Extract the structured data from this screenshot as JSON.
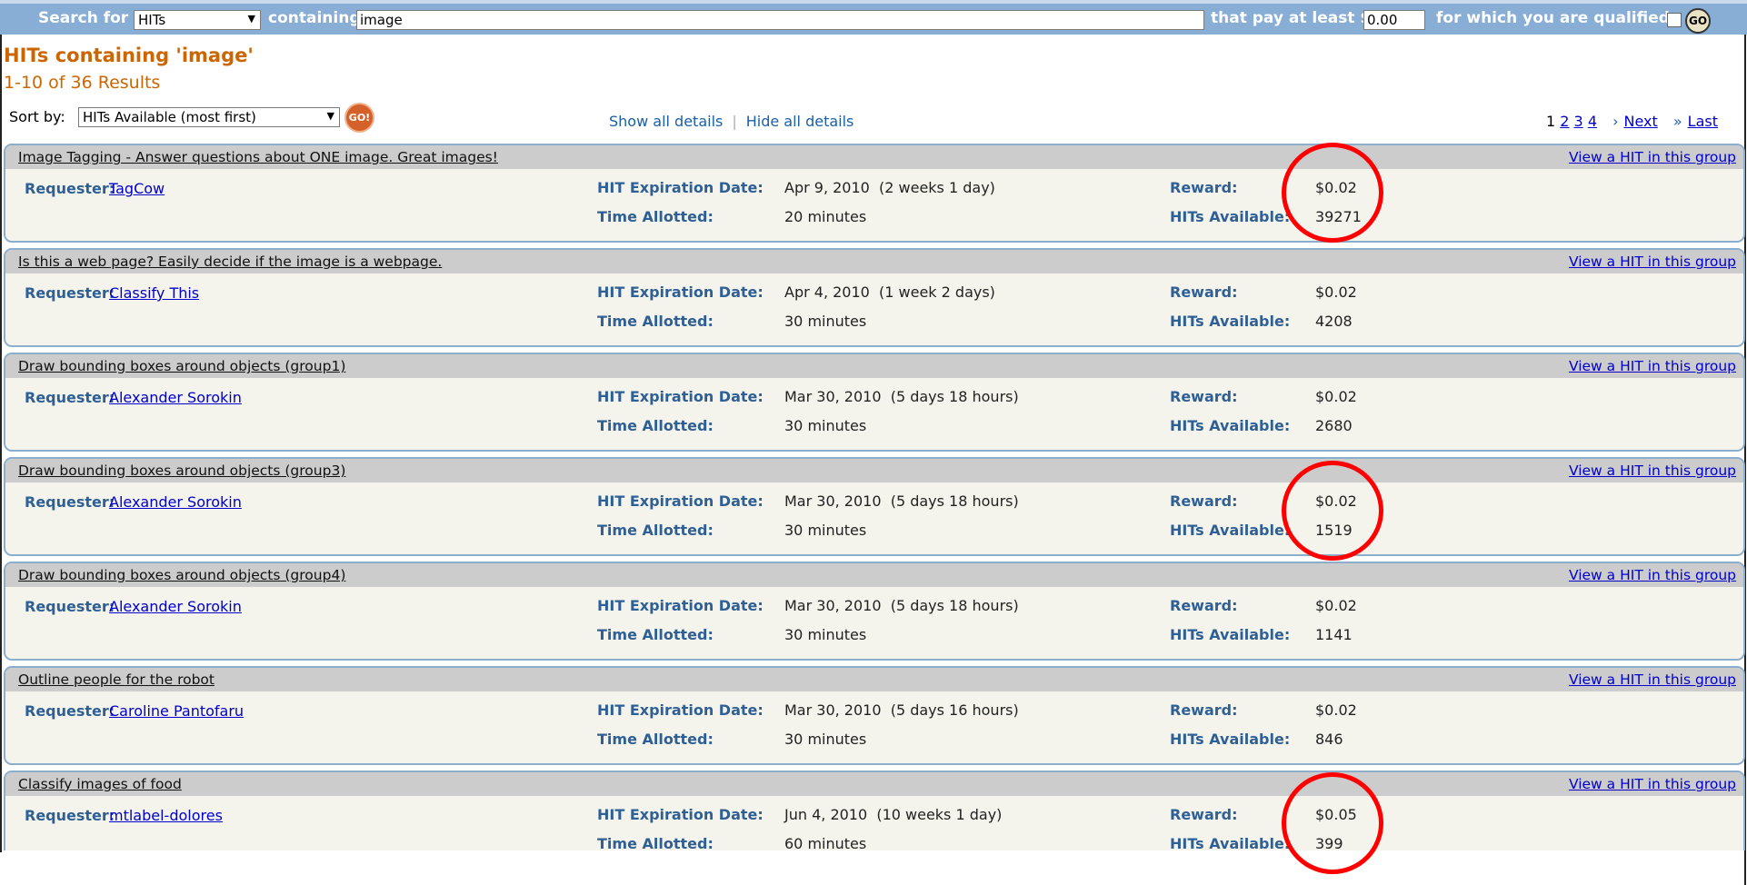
{
  "search": {
    "search_for_label": "Search for",
    "type_value": "HITs",
    "containing_label": "containing",
    "keyword_value": "image",
    "pay_label": "that pay at least $",
    "reward_value": "0.00",
    "qualified_label": "for which you are qualified",
    "go_label": "GO"
  },
  "results": {
    "heading": "HITs containing 'image'",
    "count": "1-10 of 36 Results",
    "sort_label": "Sort by:",
    "sort_value": "HITs Available (most first)",
    "sort_go": "GO!",
    "show_all": "Show all details",
    "hide_all": "Hide all details",
    "sep": "|"
  },
  "pager": {
    "pages": [
      "1",
      "2",
      "3",
      "4"
    ],
    "next": "Next",
    "last": "Last",
    "chev": "›",
    "chev2": "»"
  },
  "labels": {
    "requester": "Requester:",
    "expiration": "HIT Expiration Date:",
    "allotted": "Time Allotted:",
    "reward": "Reward:",
    "available": "HITs Available:",
    "view": "View a HIT in this group"
  },
  "hits": [
    {
      "title": "Image Tagging - Answer questions about ONE image. Great images!",
      "requester": "TagCow",
      "expiration": "Apr 9, 2010  (2 weeks 1 day)",
      "allotted": "20 minutes",
      "reward": "$0.02",
      "available": "39271"
    },
    {
      "title": "Is this a web page? Easily decide if the image is a webpage.",
      "requester": "Classify This",
      "expiration": "Apr 4, 2010  (1 week 2 days)",
      "allotted": "30 minutes",
      "reward": "$0.02",
      "available": "4208"
    },
    {
      "title": "Draw bounding boxes around objects (group1)",
      "requester": "Alexander Sorokin",
      "expiration": "Mar 30, 2010  (5 days 18 hours)",
      "allotted": "30 minutes",
      "reward": "$0.02",
      "available": "2680"
    },
    {
      "title": "Draw bounding boxes around objects (group3)",
      "requester": "Alexander Sorokin",
      "expiration": "Mar 30, 2010  (5 days 18 hours)",
      "allotted": "30 minutes",
      "reward": "$0.02",
      "available": "1519"
    },
    {
      "title": "Draw bounding boxes around objects (group4)",
      "requester": "Alexander Sorokin",
      "expiration": "Mar 30, 2010  (5 days 18 hours)",
      "allotted": "30 minutes",
      "reward": "$0.02",
      "available": "1141"
    },
    {
      "title": "Outline people for the robot",
      "requester": "Caroline Pantofaru",
      "expiration": "Mar 30, 2010  (5 days 16 hours)",
      "allotted": "30 minutes",
      "reward": "$0.02",
      "available": "846"
    },
    {
      "title": "Classify images of food",
      "requester": "mtlabel-dolores",
      "expiration": "Jun 4, 2010  (10 weeks 1 day)",
      "allotted": "60 minutes",
      "reward": "$0.05",
      "available": "399"
    }
  ],
  "colors": {
    "annotation": "#ff0000",
    "header_bar": "#88aed5",
    "accent": "#cc6600",
    "label_blue": "#2e5f95"
  }
}
